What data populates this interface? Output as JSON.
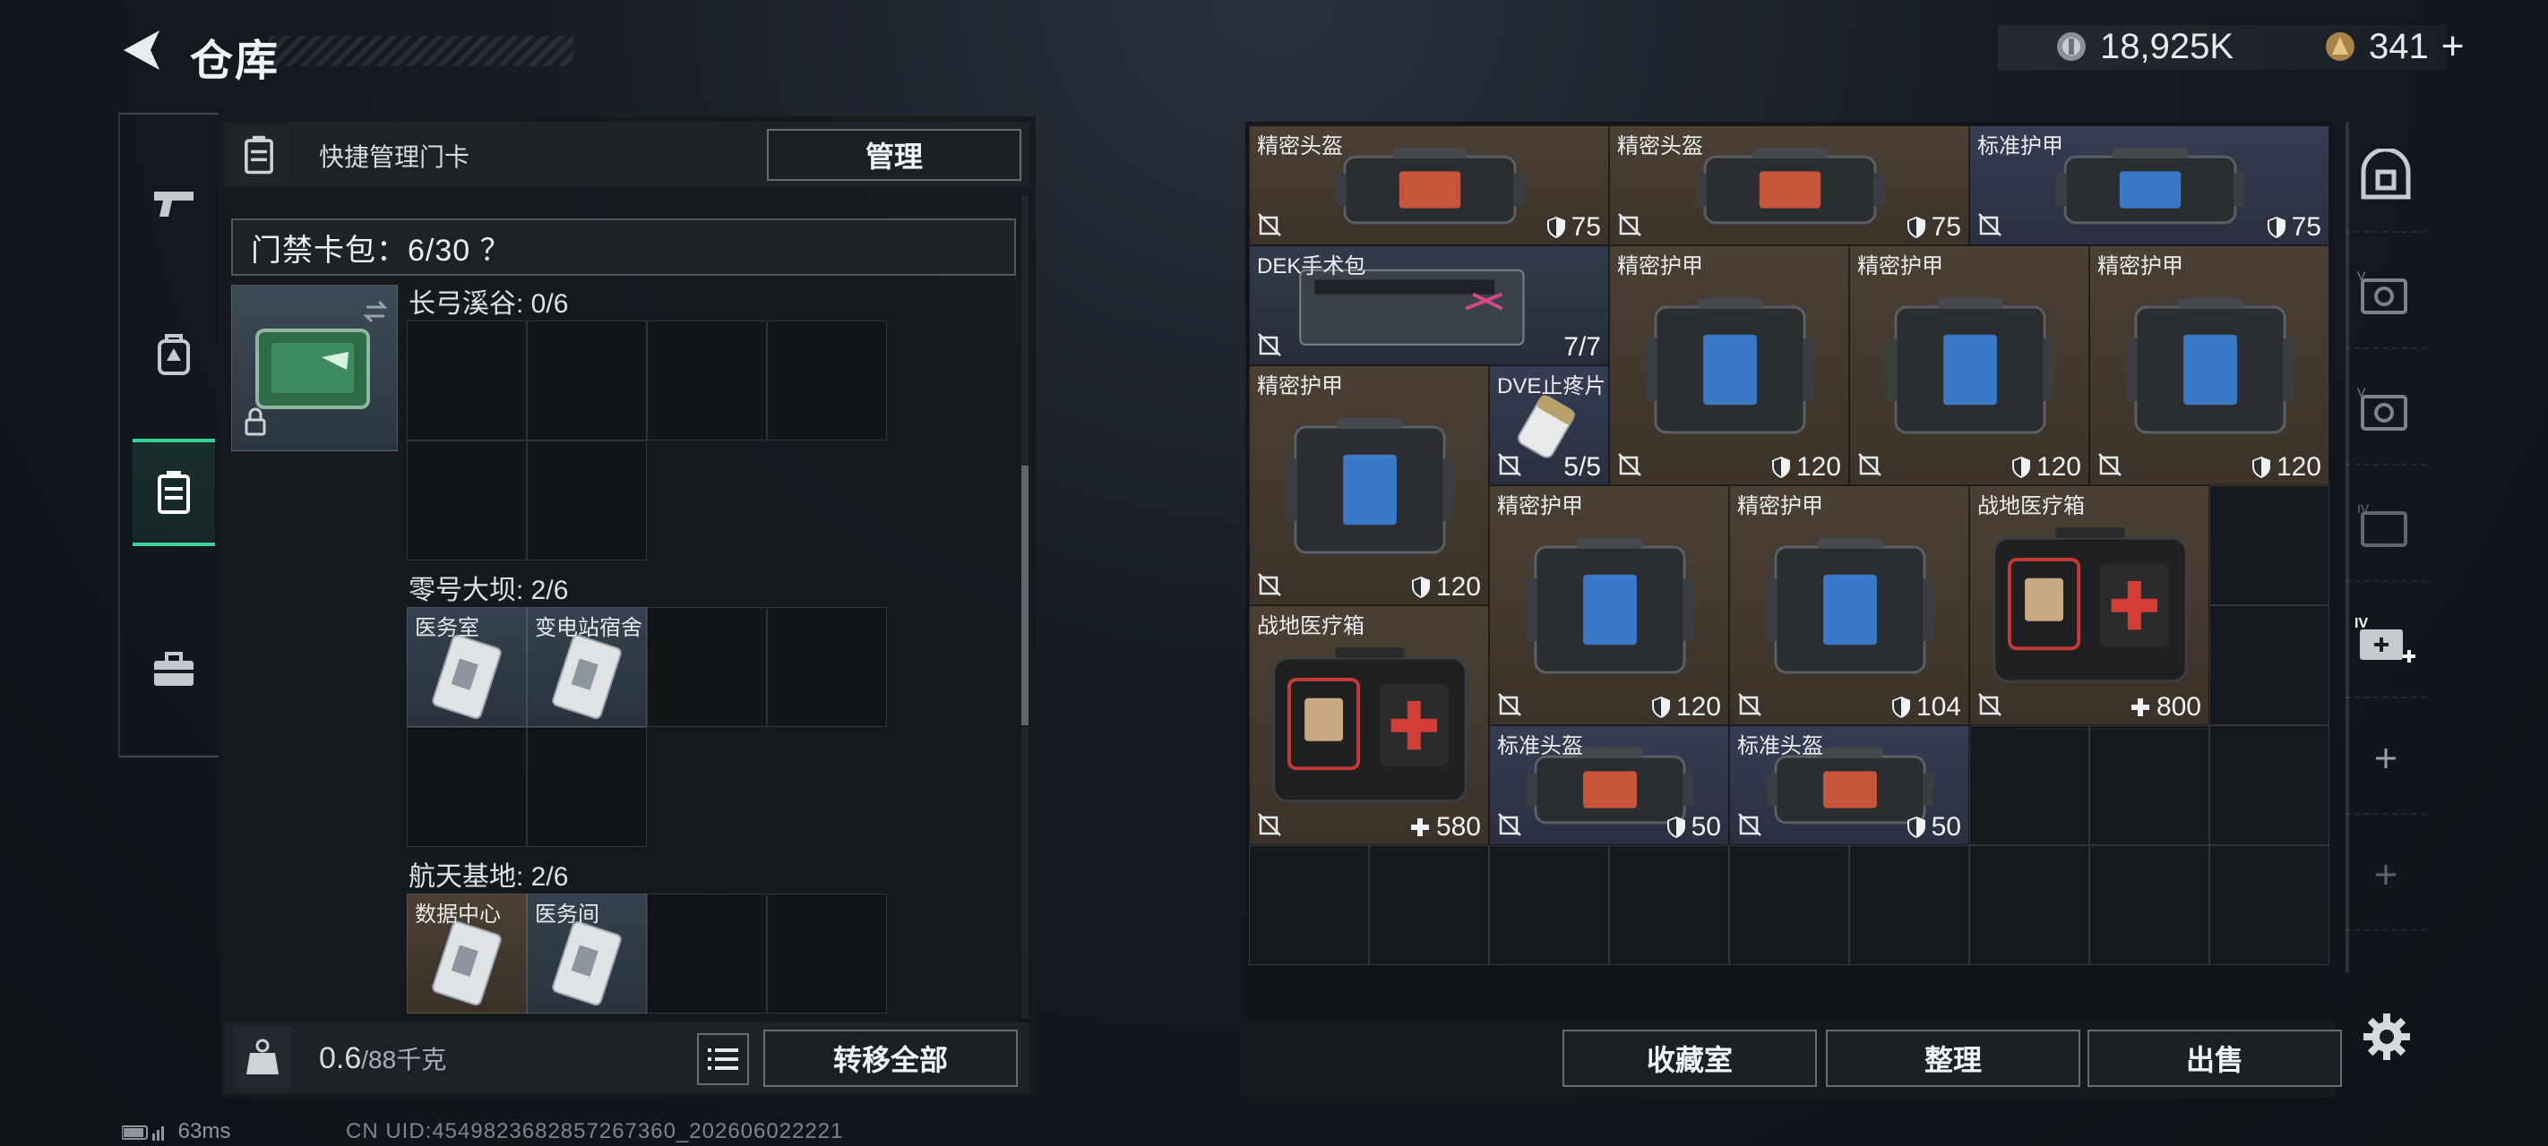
{
  "header": {
    "title": "仓库",
    "currency1": "18,925K",
    "currency2": "341",
    "currency2_plus": "+"
  },
  "left_nav": {
    "items": [
      "weapon",
      "backpack",
      "keycard",
      "toolbox"
    ],
    "active": "keycard"
  },
  "keycard_panel": {
    "header_label": "快捷管理门卡",
    "manage_label": "管理",
    "cardpack_label": "门禁卡包：6/30 ？",
    "regions": [
      {
        "label": "长弓溪谷: 0/6",
        "cards": []
      },
      {
        "label": "零号大坝: 2/6",
        "cards": [
          "医务室",
          "变电站宿舍"
        ]
      },
      {
        "label": "航天基地: 2/6",
        "cards": [
          "数据中心",
          "医务间"
        ]
      }
    ],
    "weight_current": "0.6",
    "weight_max": "/88千克",
    "transfer_label": "转移全部"
  },
  "inventory": {
    "items": [
      {
        "name": "精密头盔",
        "value": "75",
        "kind": "helmet"
      },
      {
        "name": "精密头盔",
        "value": "75",
        "kind": "helmet"
      },
      {
        "name": "标准护甲",
        "value": "75",
        "kind": "armor"
      },
      {
        "name": "DEK手术包",
        "value": "7/7",
        "kind": "surgery"
      },
      {
        "name": "精密护甲",
        "value": "120",
        "kind": "armor"
      },
      {
        "name": "精密护甲",
        "value": "120",
        "kind": "armor"
      },
      {
        "name": "精密护甲",
        "value": "120",
        "kind": "armor"
      },
      {
        "name": "精密护甲",
        "value": "120",
        "kind": "armor"
      },
      {
        "name": "DVE止疼片",
        "value": "5/5",
        "kind": "pills"
      },
      {
        "name": "精密护甲",
        "value": "120",
        "kind": "armor"
      },
      {
        "name": "精密护甲",
        "value": "104",
        "kind": "armor"
      },
      {
        "name": "战地医疗箱",
        "value": "800",
        "kind": "medkit"
      },
      {
        "name": "战地医疗箱",
        "value": "580",
        "kind": "medkit"
      },
      {
        "name": "标准头盔",
        "value": "50",
        "kind": "helmet"
      },
      {
        "name": "标准头盔",
        "value": "50",
        "kind": "helmet"
      }
    ],
    "buttons": {
      "collection": "收藏室",
      "sort": "整理",
      "sell": "出售"
    }
  },
  "right_nav": {
    "items": [
      "safe-icon",
      "case-v1-icon",
      "case-v2-icon",
      "case-iv-icon",
      "case-iv-plus-icon",
      "add-slot-icon",
      "add-slot-icon-faded"
    ]
  },
  "status": {
    "latency": "63ms",
    "uid": "CN UID:4549823682857267360_202606022221"
  },
  "colors": {
    "accent_green": "#38d39a",
    "bg": "#161b22",
    "item_brown": "#4b4034",
    "item_blue": "#363c52"
  }
}
